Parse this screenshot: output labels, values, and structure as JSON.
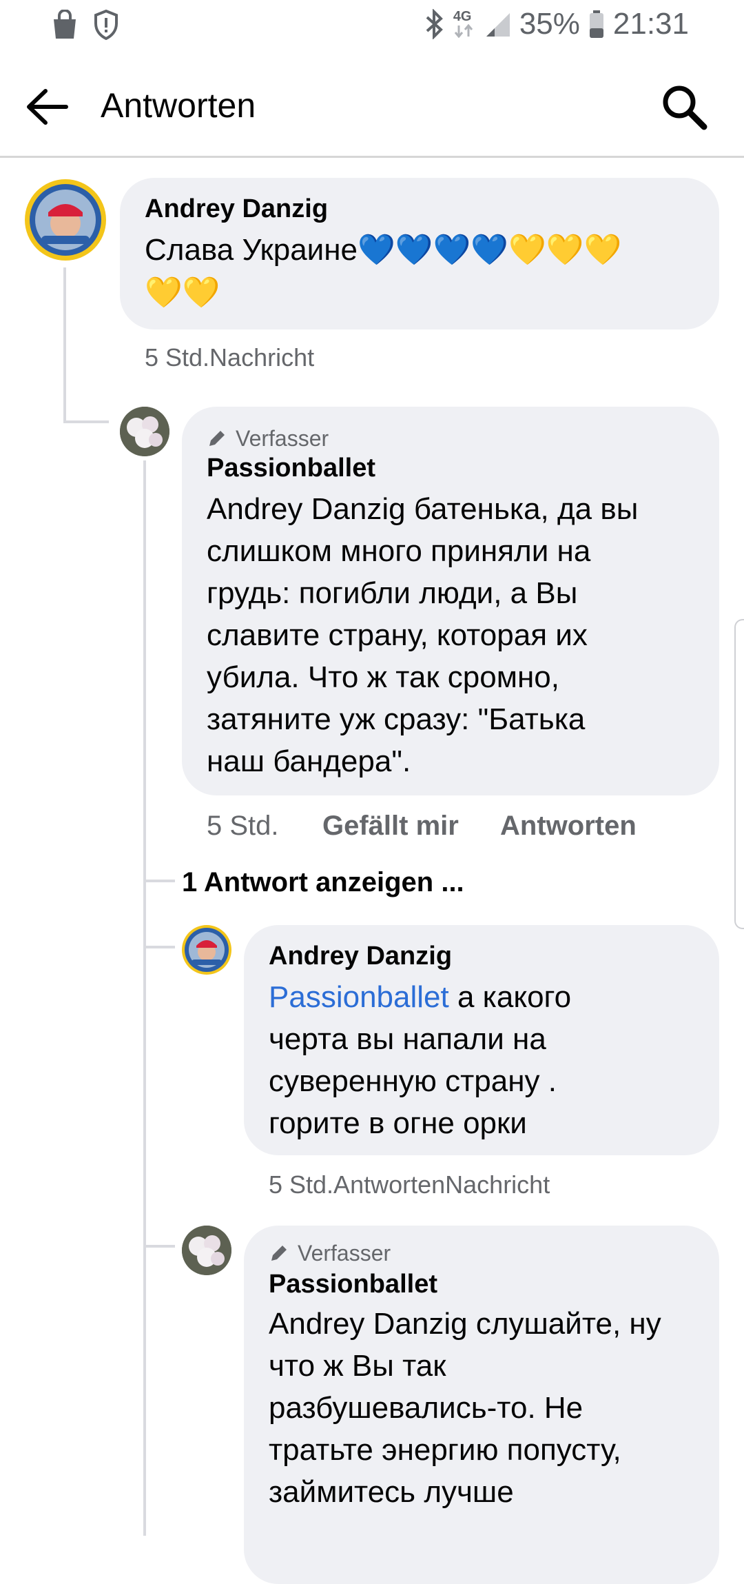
{
  "status_bar": {
    "battery": "35%",
    "time": "21:31",
    "network": "4G",
    "icons": [
      "shopping-bag-icon",
      "shield-alert-icon",
      "bluetooth-icon",
      "mobile-data-icon",
      "signal-icon",
      "battery-icon"
    ]
  },
  "app_bar": {
    "title": "Antworten",
    "back_icon": "arrow-left-icon",
    "search_icon": "search-icon"
  },
  "comments": [
    {
      "name": "Andrey Danzig",
      "text_line1": "Слава Украине💙💙💙💙💛💛💛",
      "text_line2": "💛💛",
      "meta": "5 Std.Nachricht"
    },
    {
      "badge": "Verfasser",
      "name": "Passionballet",
      "lines": [
        "Andrey Danzig батенька, да вы",
        "слишком много приняли на",
        "грудь: погибли люди, а Вы",
        "славите страну, которая их",
        "убила. Что ж так сромно,",
        "затяните уж сразу: \"Батька",
        "наш бандера\"."
      ],
      "time": "5 Std.",
      "like": "Gefällt mir",
      "reply": "Antworten"
    }
  ],
  "show_replies": "1 Antwort anzeigen ...",
  "replies": [
    {
      "name": "Andrey Danzig",
      "mention": "Passionballet",
      "line1_rest": " а какого",
      "lines": [
        "черта вы напали на",
        "суверенную страну .",
        "горите в огне орки"
      ],
      "meta": "5 Std.AntwortenNachricht"
    },
    {
      "badge": "Verfasser",
      "name": "Passionballet",
      "lines": [
        "Andrey Danzig слушайте, ну",
        "что ж Вы так",
        "разбушевались-то. Не",
        "тратьте энергию попусту,",
        "займитесь лучше"
      ]
    }
  ],
  "colors": {
    "bubble": "#eff0f4",
    "mention": "#2b6dd6",
    "meta": "#65676b",
    "avatar_ring": "#f3c51a"
  }
}
